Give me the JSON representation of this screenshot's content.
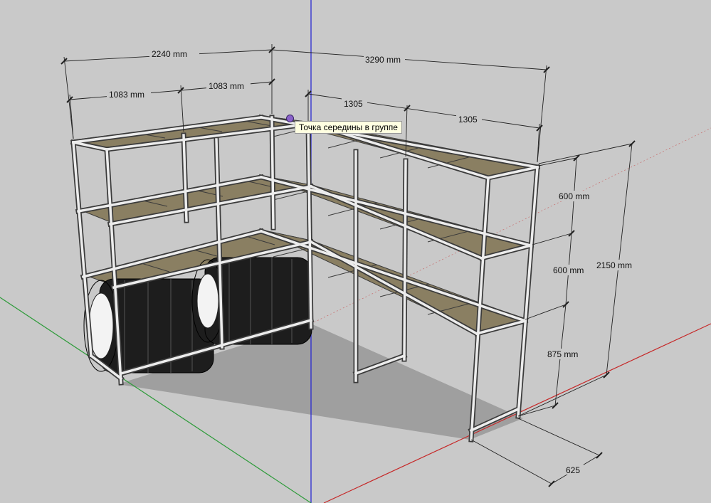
{
  "tooltip": "Точка середины в группе",
  "dimensions": {
    "left_total": "2240 mm",
    "left_half_a": "1083 mm",
    "left_half_b": "1083 mm",
    "right_total": "3290 mm",
    "right_half_a": "1305",
    "right_half_b": "1305",
    "height_top": "600 mm",
    "height_mid": "600 mm",
    "height_bottom": "875 mm",
    "height_total": "2150 mm",
    "depth": "625"
  },
  "colors": {
    "background": "#c9c9c9",
    "floor": "#9f9f9f",
    "frame": "#e9e9e9",
    "frame_edge": "#3b3b3b",
    "shelf_board": "#8a7f62",
    "tire": "#1d1d1d",
    "rim": "#f3f3f3",
    "axis_red": "#c62828",
    "axis_green": "#2e9b3a",
    "axis_blue": "#2a2ad0",
    "tooltip_bg": "#ffffe1",
    "cursor_dot": "#8a62c9"
  },
  "icons": [
    "midpoint-snap-icon"
  ]
}
